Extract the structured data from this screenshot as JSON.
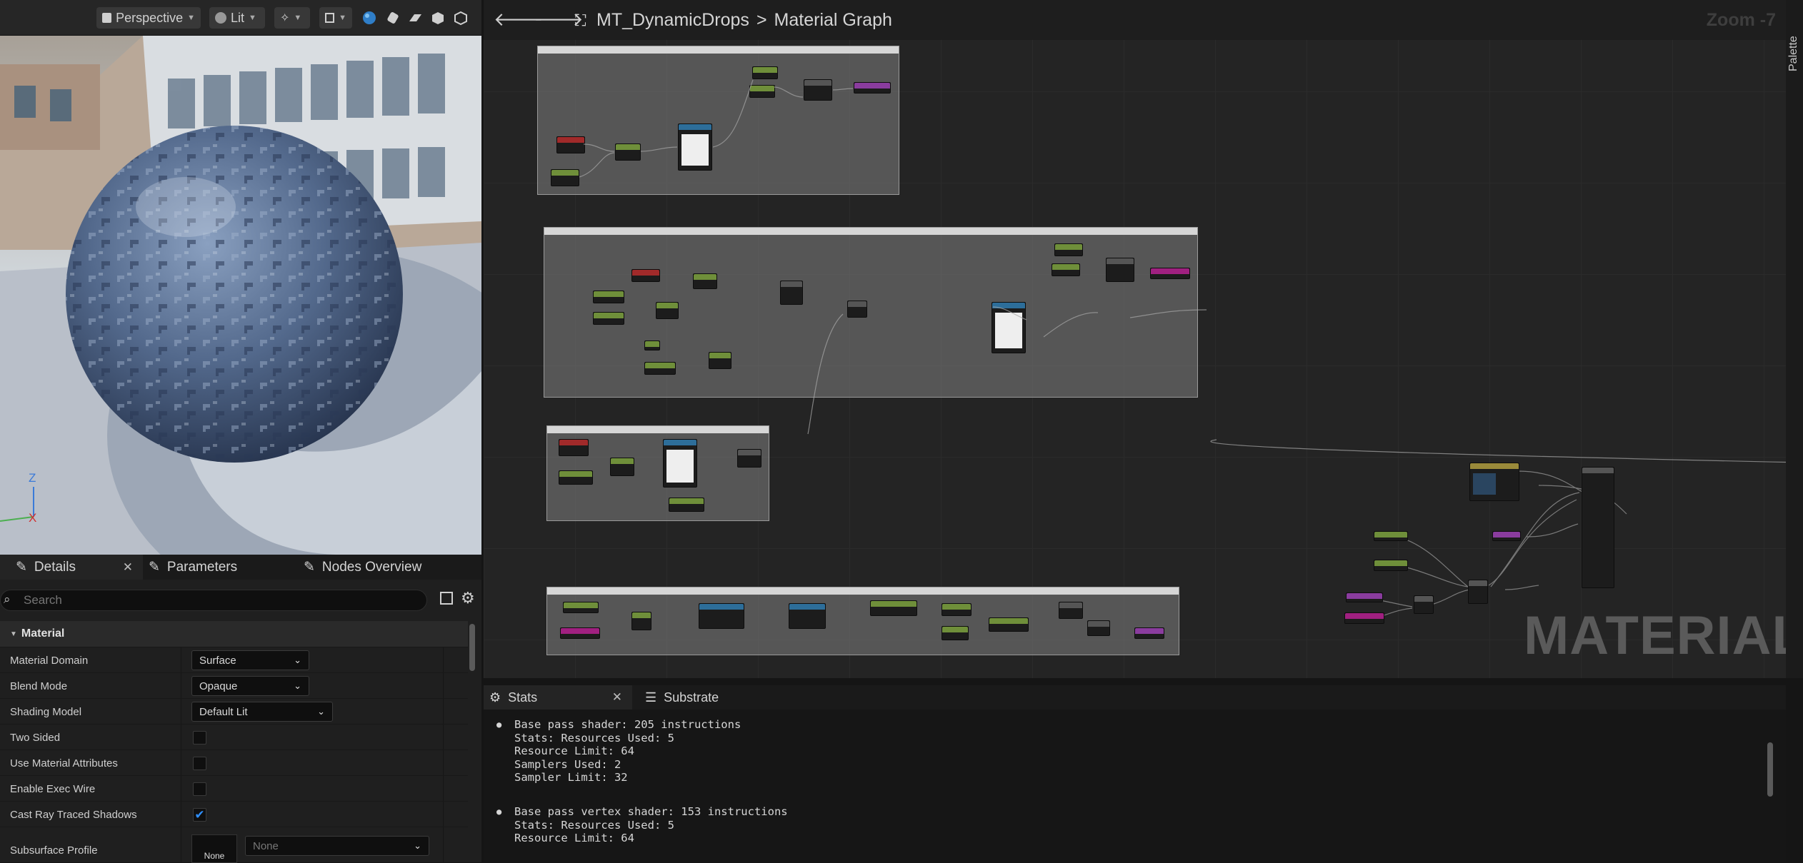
{
  "viewport": {
    "view_mode": "Perspective",
    "lit_mode": "Lit",
    "axes": {
      "z": "Z",
      "x": "X"
    }
  },
  "details_tabs": [
    {
      "label": "Details",
      "active": true
    },
    {
      "label": "Parameters"
    },
    {
      "label": "Nodes Overview"
    }
  ],
  "details": {
    "search_placeholder": "Search",
    "category": "Material",
    "properties": [
      {
        "label": "Material Domain",
        "kind": "dropdown",
        "value": "Surface"
      },
      {
        "label": "Blend Mode",
        "kind": "dropdown",
        "value": "Opaque"
      },
      {
        "label": "Shading Model",
        "kind": "dropdown",
        "value": "Default Lit"
      },
      {
        "label": "Two Sided",
        "kind": "checkbox",
        "checked": false
      },
      {
        "label": "Use Material Attributes",
        "kind": "checkbox",
        "checked": false
      },
      {
        "label": "Enable Exec Wire",
        "kind": "checkbox",
        "checked": false
      },
      {
        "label": "Cast Ray Traced Shadows",
        "kind": "checkbox",
        "checked": true
      },
      {
        "label": "Subsurface Profile",
        "kind": "asset",
        "thumb": "None",
        "value": "None"
      }
    ]
  },
  "graph": {
    "breadcrumb_asset": "MT_DynamicDrops",
    "breadcrumb_separator": ">",
    "breadcrumb_graph": "Material Graph",
    "zoom": "Zoom -7",
    "watermark": "MATERIAL",
    "palette_label": "Palette"
  },
  "stats_tabs": [
    {
      "label": "Stats",
      "active": true
    },
    {
      "label": "Substrate"
    }
  ],
  "stats": {
    "block1": [
      "Base pass shader: 205 instructions",
      "Stats: Resources Used: 5",
      "Resource Limit: 64",
      "Samplers Used: 2",
      "Sampler Limit: 32"
    ],
    "block2": [
      "Base pass vertex shader: 153 instructions",
      "Stats: Resources Used: 5",
      "Resource Limit: 64"
    ]
  },
  "colors": {
    "accent": "#2f8fff",
    "checkbox_tick": "#2f8fff"
  }
}
